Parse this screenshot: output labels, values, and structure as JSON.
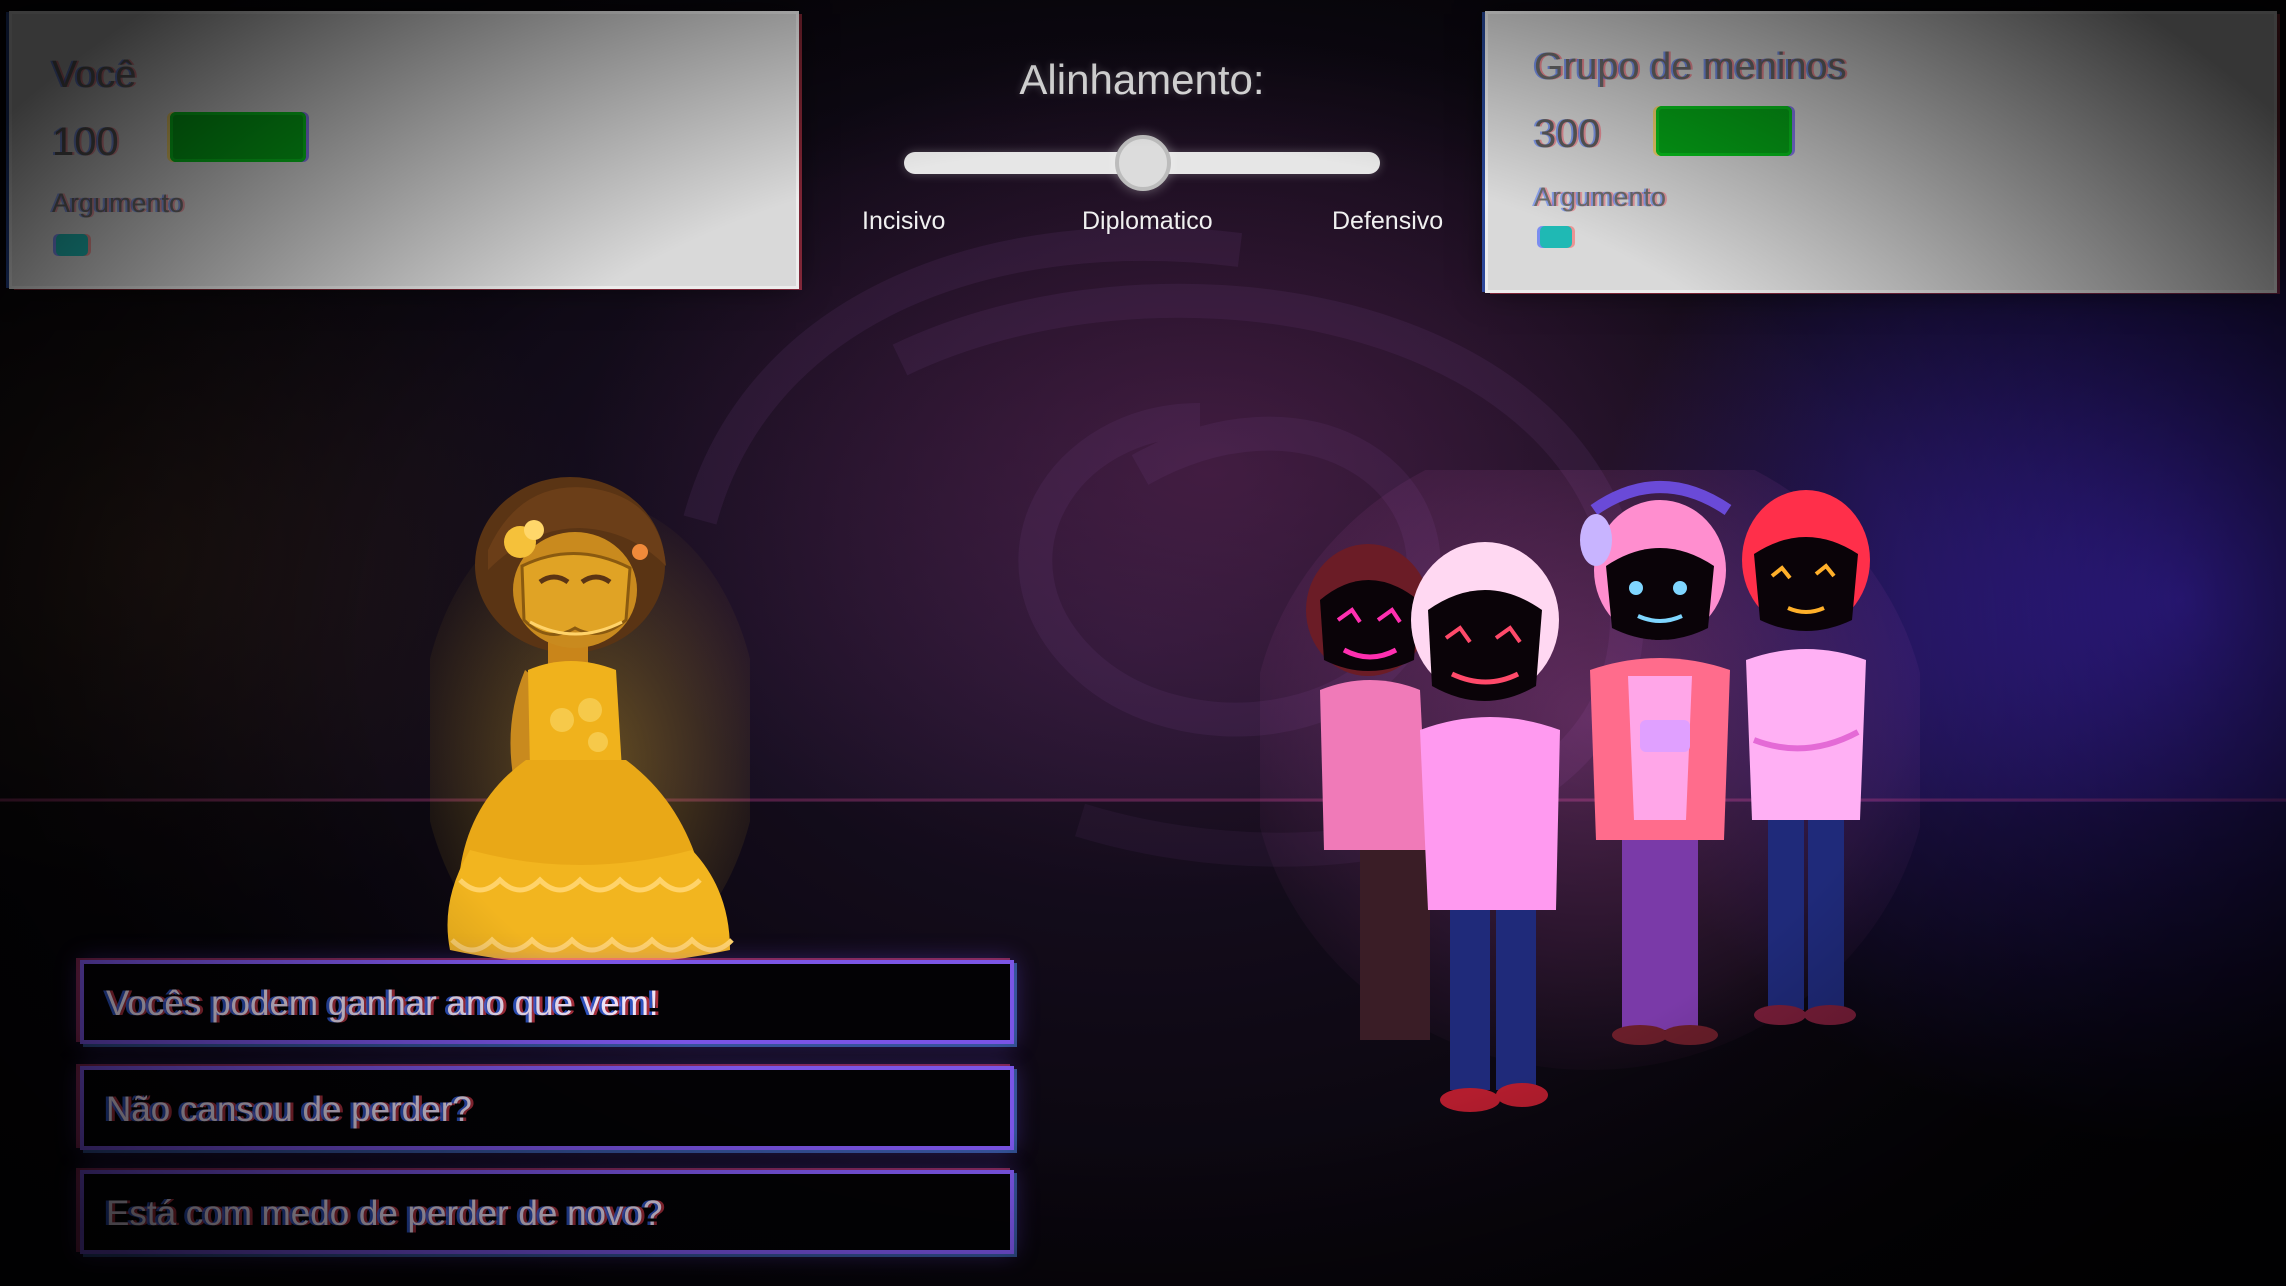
{
  "player": {
    "name": "Você",
    "hp": "100",
    "argument_label": "Argumento",
    "hp_fraction": 1.0
  },
  "enemy": {
    "name": "Grupo de meninos",
    "hp": "300",
    "argument_label": "Argumento",
    "hp_fraction": 1.0
  },
  "alignment": {
    "title": "Alinhamento:",
    "options": [
      "Incisivo",
      "Diplomatico",
      "Defensivo"
    ],
    "selected": "Diplomatico"
  },
  "dialogue_options": [
    "Vocês podem ganhar ano que vem!",
    "Não cansou de perder?",
    "Está com medo de perder de novo?"
  ],
  "colors": {
    "health_bar": "#05a617",
    "argument_chip": "#1fb9b4",
    "option_border": "#7b55e6",
    "player_tint": "#f2b824",
    "enemy_tint": "#ff78e6"
  },
  "icons": {
    "player_character": "masked-girl-yellow-dress",
    "enemy_characters": [
      "masked-boy-brown-hair",
      "masked-boy-white-hair",
      "masked-boy-headphones",
      "masked-boy-red-hair"
    ]
  }
}
